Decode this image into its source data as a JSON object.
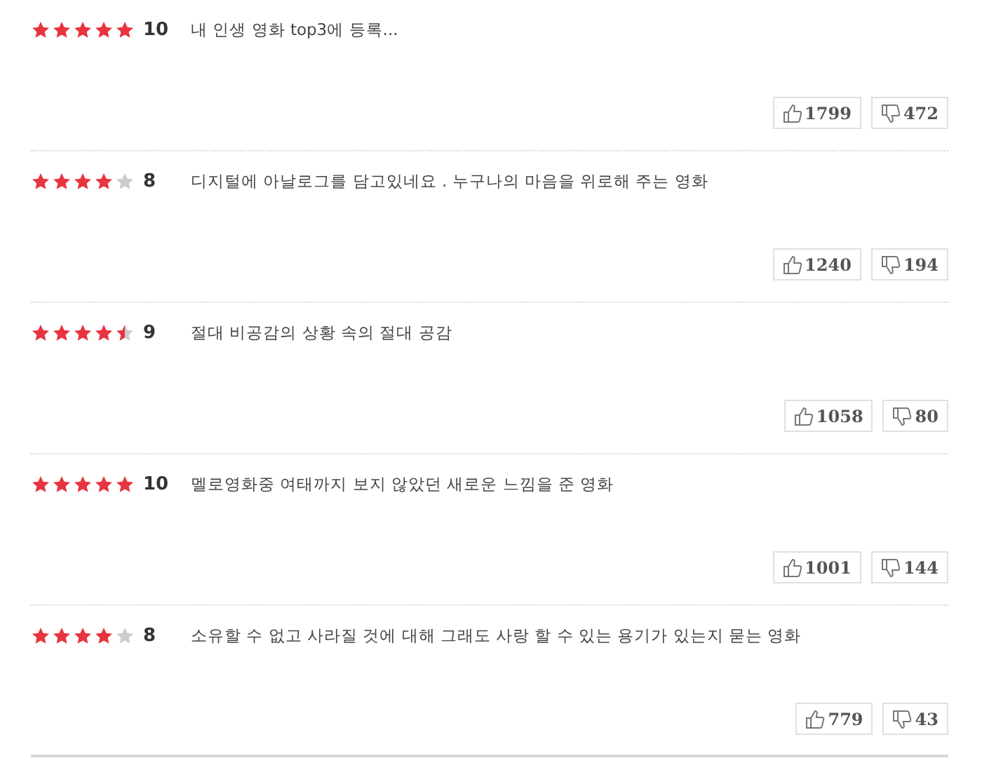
{
  "reviews": [
    {
      "stars": 5,
      "score": "10",
      "text": "내 인생 영화 top3에 등록...",
      "likes": "1799",
      "dislikes": "472"
    },
    {
      "stars": 4,
      "score": "8",
      "text": "디지털에 아날로그를 담고있네요 . 누구나의 마음을 위로해 주는 영화",
      "likes": "1240",
      "dislikes": "194"
    },
    {
      "stars": 4.5,
      "score": "9",
      "text": "절대 비공감의 상황 속의 절대 공감",
      "likes": "1058",
      "dislikes": "80"
    },
    {
      "stars": 5,
      "score": "10",
      "text": "멜로영화중 여태까지 보지 않았던 새로운 느낌을 준 영화",
      "likes": "1001",
      "dislikes": "144"
    },
    {
      "stars": 4,
      "score": "8",
      "text": "소유할 수 없고 사라질 것에 대해 그래도 사랑 할 수 있는 용기가 있는지 묻는 영화",
      "likes": "779",
      "dislikes": "43"
    }
  ]
}
